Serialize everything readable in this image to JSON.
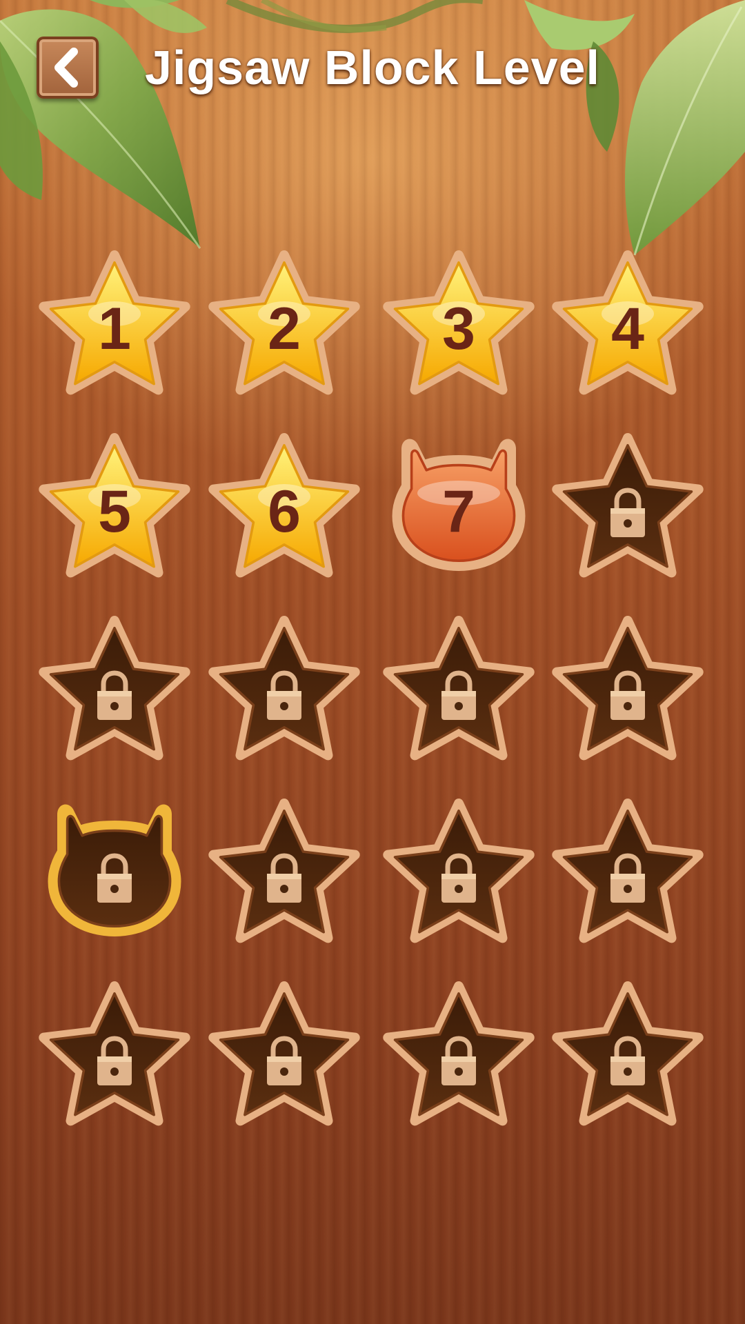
{
  "header": {
    "title": "Jigsaw Block Level",
    "back_icon": "chevron-left-icon"
  },
  "colors": {
    "wood": "#9f4e26",
    "star_gold": "#fcc21b",
    "star_rim": "#c0773e",
    "current_orange": "#e8682a",
    "locked_fill": "#4a260d",
    "lock_color": "#e0b48c",
    "number_color": "#6a2516"
  },
  "levels": [
    {
      "label": "1",
      "state": "completed",
      "shape": "star"
    },
    {
      "label": "2",
      "state": "completed",
      "shape": "star"
    },
    {
      "label": "3",
      "state": "completed",
      "shape": "star"
    },
    {
      "label": "4",
      "state": "completed",
      "shape": "star"
    },
    {
      "label": "5",
      "state": "completed",
      "shape": "star"
    },
    {
      "label": "6",
      "state": "completed",
      "shape": "star"
    },
    {
      "label": "7",
      "state": "current",
      "shape": "cat"
    },
    {
      "label": "",
      "state": "locked",
      "shape": "star"
    },
    {
      "label": "",
      "state": "locked",
      "shape": "star"
    },
    {
      "label": "",
      "state": "locked",
      "shape": "star"
    },
    {
      "label": "",
      "state": "locked",
      "shape": "star"
    },
    {
      "label": "",
      "state": "locked",
      "shape": "star"
    },
    {
      "label": "",
      "state": "locked",
      "shape": "cat"
    },
    {
      "label": "",
      "state": "locked",
      "shape": "star"
    },
    {
      "label": "",
      "state": "locked",
      "shape": "star"
    },
    {
      "label": "",
      "state": "locked",
      "shape": "star"
    },
    {
      "label": "",
      "state": "locked",
      "shape": "star"
    },
    {
      "label": "",
      "state": "locked",
      "shape": "star"
    },
    {
      "label": "",
      "state": "locked",
      "shape": "star"
    },
    {
      "label": "",
      "state": "locked",
      "shape": "star"
    }
  ]
}
